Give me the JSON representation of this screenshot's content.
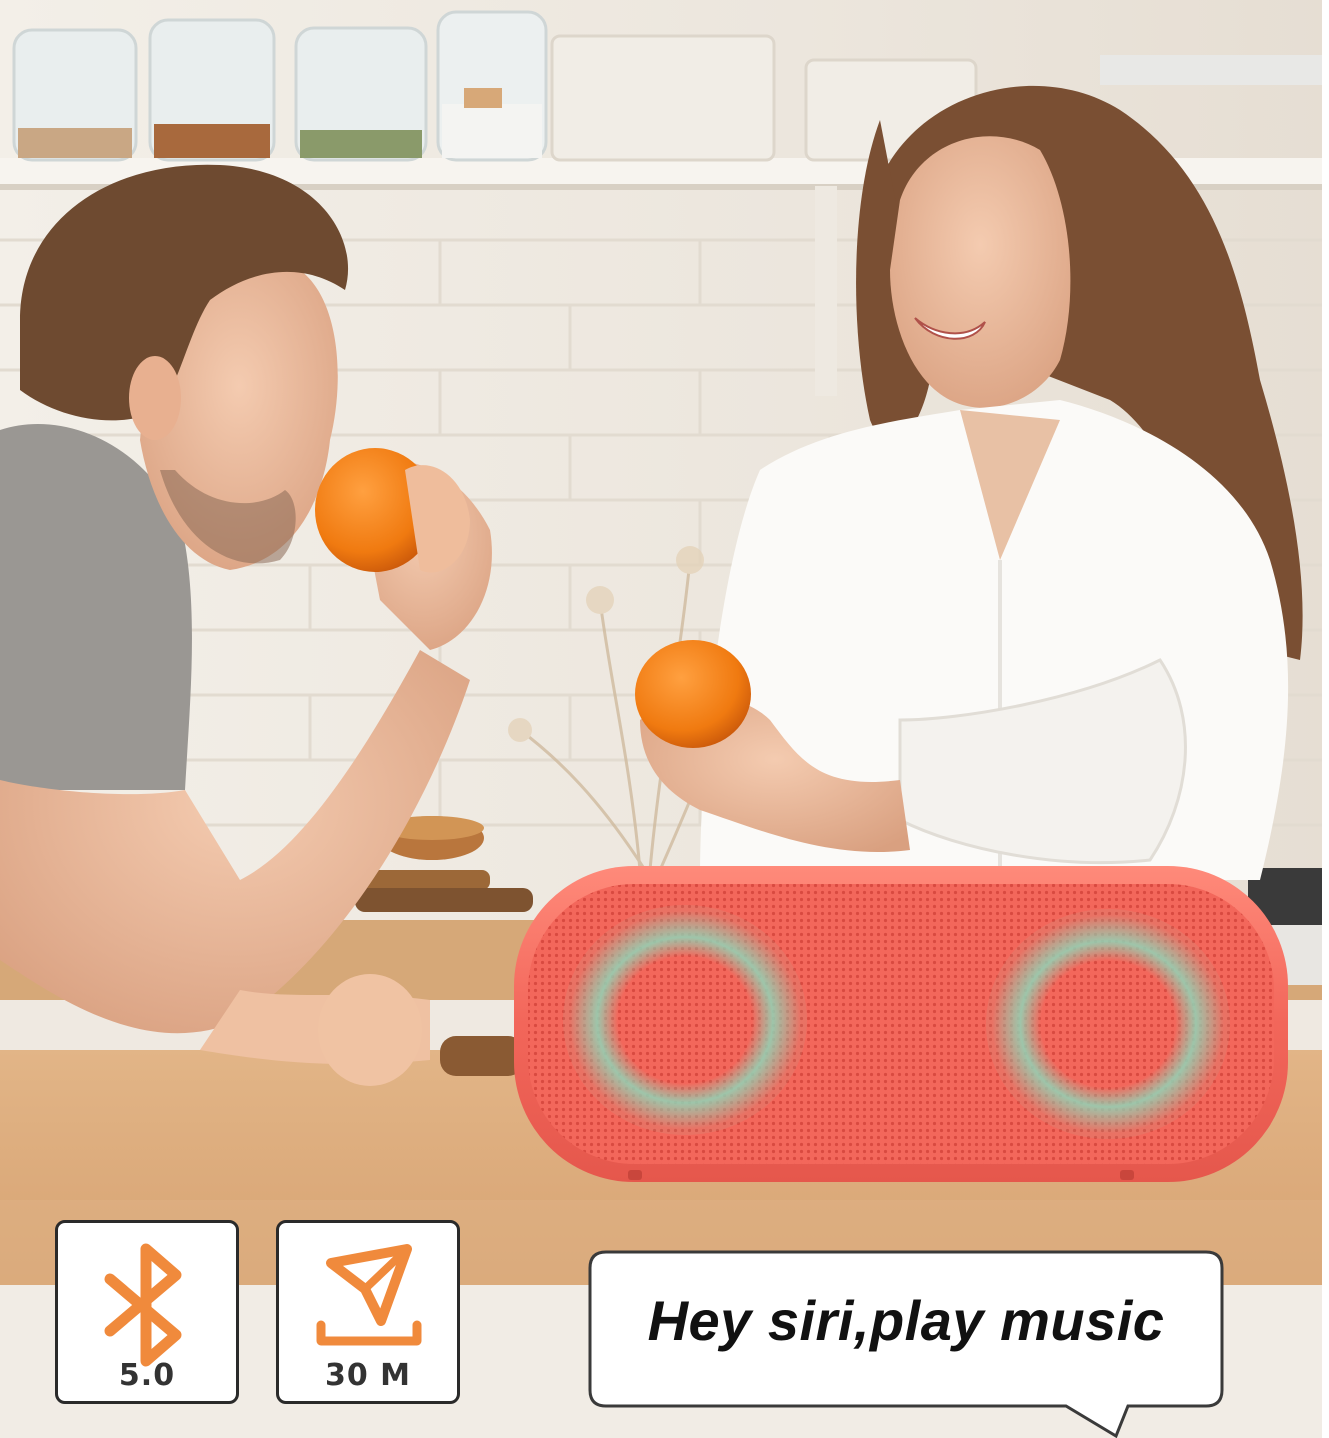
{
  "badges": [
    {
      "icon": "bluetooth-icon",
      "label": "5.0"
    },
    {
      "icon": "range-send-icon",
      "label": "30 M"
    }
  ],
  "speech": {
    "text": "Hey siri,play music"
  },
  "colors": {
    "accent_orange": "#f08a3c",
    "speaker_red": "#f0655a",
    "speaker_light_ring": "#8fd6b8",
    "badge_border": "#2a2a2a",
    "bubble_border": "#3a3a3a"
  }
}
